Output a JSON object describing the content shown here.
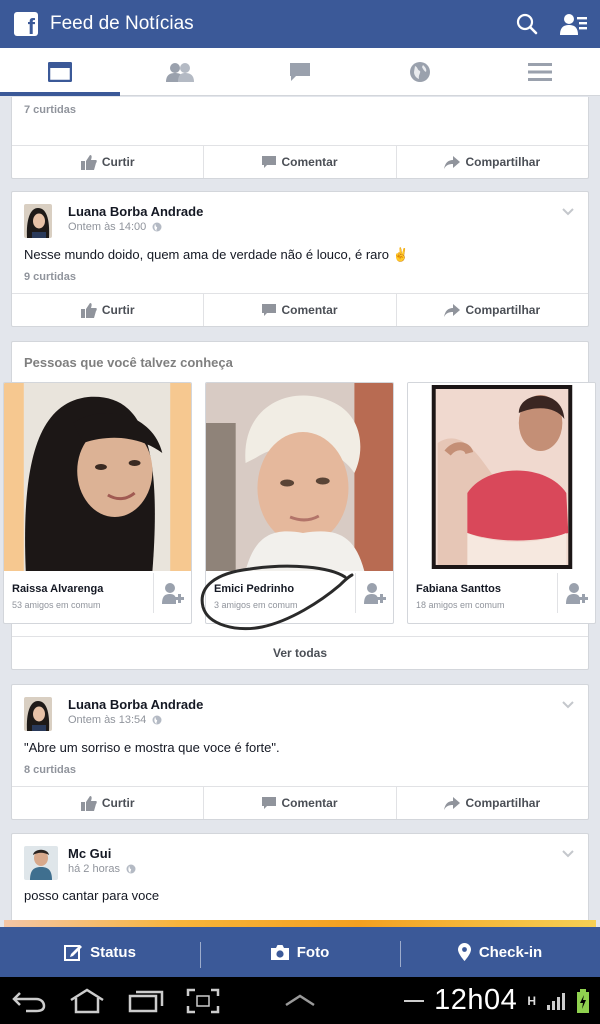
{
  "header": {
    "title": "Feed de Notícias",
    "logo_letter": "f"
  },
  "tabs": [
    {
      "icon": "news-feed-icon",
      "active": true
    },
    {
      "icon": "friends-icon",
      "active": false
    },
    {
      "icon": "messages-icon",
      "active": false
    },
    {
      "icon": "globe-icon",
      "active": false
    },
    {
      "icon": "menu-icon",
      "active": false
    }
  ],
  "actions": {
    "like": "Curtir",
    "comment": "Comentar",
    "share": "Compartilhar"
  },
  "posts": [
    {
      "likes": "7 curtidas"
    },
    {
      "author": "Luana Borba Andrade",
      "time": "Ontem às 14:00",
      "text": "Nesse mundo doido, quem ama de verdade não é louco, é raro ✌",
      "likes": "9 curtidas"
    },
    {
      "author": "Luana Borba Andrade",
      "time": "Ontem às 13:54",
      "text": "\"Abre um sorriso e mostra que voce é forte\".",
      "likes": "8 curtidas"
    },
    {
      "author": "Mc Gui",
      "time": "há 2 horas",
      "text": "posso cantar para voce"
    }
  ],
  "pymk": {
    "title": "Pessoas que você talvez conheça",
    "people": [
      {
        "name": "Raissa Alvarenga",
        "mutual": "53 amigos em comum"
      },
      {
        "name": "Emici Pedrinho",
        "mutual": "3 amigos em comum"
      },
      {
        "name": "Fabiana Santtos",
        "mutual": "18 amigos em comum"
      }
    ],
    "see_all": "Ver todas"
  },
  "composer": {
    "status": "Status",
    "photo": "Foto",
    "checkin": "Check-in"
  },
  "system": {
    "clock": "12h04",
    "network": "H"
  },
  "colors": {
    "brand": "#3b5998",
    "background": "#e3e6ec"
  }
}
